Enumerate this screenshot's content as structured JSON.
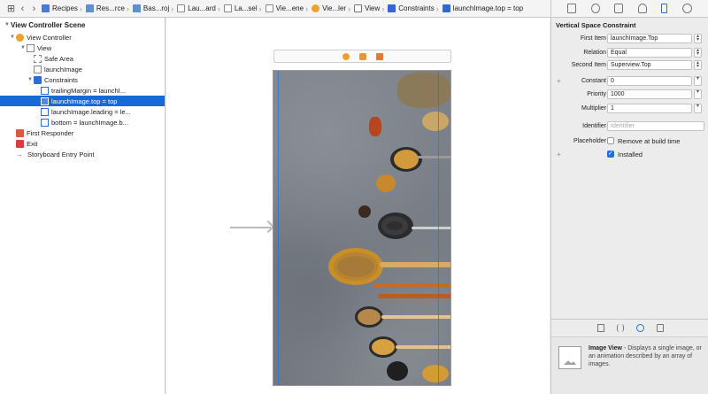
{
  "jumpbar": {
    "crumbs": [
      {
        "label": "Recipes",
        "icon": "blueprint-icon"
      },
      {
        "label": "Res...rce",
        "icon": "folder-icon"
      },
      {
        "label": "Bas...roj",
        "icon": "folder-icon"
      },
      {
        "label": "Lau...ard",
        "icon": "file-icon"
      },
      {
        "label": "La...sel",
        "icon": "file-icon"
      },
      {
        "label": "Vie...ene",
        "icon": "storyboard-icon"
      },
      {
        "label": "Vie...ler",
        "icon": "view-controller-icon"
      },
      {
        "label": "View",
        "icon": "view-icon"
      },
      {
        "label": "Constraints",
        "icon": "constraints-icon"
      },
      {
        "label": "launchImage.top = top",
        "icon": "constraint-icon"
      }
    ]
  },
  "outline": {
    "scene_title": "View Controller Scene",
    "rows": [
      {
        "label": "View Controller"
      },
      {
        "label": "View"
      },
      {
        "label": "Safe Area"
      },
      {
        "label": "launchImage"
      },
      {
        "label": "Constraints"
      },
      {
        "label": "trailingMargin = launchI..."
      },
      {
        "label": "launchImage.top = top"
      },
      {
        "label": "launchImage.leading = le..."
      },
      {
        "label": "bottom = launchImage.b..."
      },
      {
        "label": "First Responder"
      },
      {
        "label": "Exit"
      },
      {
        "label": "Storyboard Entry Point"
      }
    ],
    "selected_index": 6
  },
  "inspector": {
    "title": "Vertical Space Constraint",
    "first_item_label": "First Item",
    "first_item_value": "launchImage.Top",
    "relation_label": "Relation",
    "relation_value": "Equal",
    "second_item_label": "Second Item",
    "second_item_value": "Superview.Top",
    "constant_label": "Constant",
    "constant_value": "0",
    "priority_label": "Priority",
    "priority_value": "1000",
    "multiplier_label": "Multiplier",
    "multiplier_value": "1",
    "identifier_label": "Identifier",
    "identifier_placeholder": "Identifier",
    "placeholder_label": "Placeholder",
    "remove_at_build_label": "Remove at build time",
    "installed_label": "Installed",
    "installed_checked": true,
    "remove_at_build_checked": false
  },
  "library": {
    "item_name": "Image View",
    "item_desc": " - Displays a single image, or an animation described by an array of images."
  },
  "colors": {
    "selection": "#1869d8",
    "accent": "#1c6fe6",
    "canvas_bg": "#ffffff",
    "panel_bg": "#ececec"
  }
}
